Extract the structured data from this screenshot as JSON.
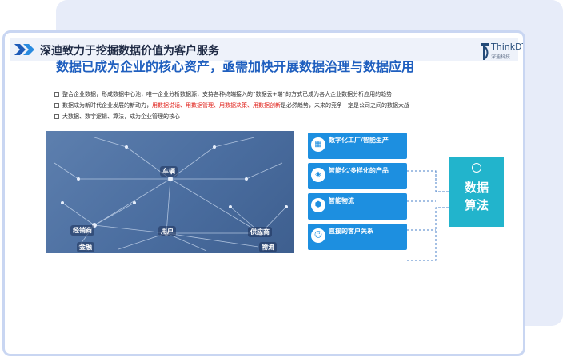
{
  "header": {
    "title": "深迪致力于挖掘数据价值为客户服务"
  },
  "logo": {
    "name": "ThinkDT",
    "subtitle": "深迪科技"
  },
  "headline": "数据已成为企业的核心资产，亟需加快开展数据治理与数据应用",
  "bullets": {
    "b1": "整合企业数据，形成数据中心池，唯一企业分析数据源，支持各种终端接入的“数据云+端”的方式已成为各大企业数据分析应用的趋势",
    "b2_prefix": "数据成为新时代企业发展的新动力，",
    "b2_highlight": "用数据说话、用数据管理、用数据决策、用数据创新",
    "b2_suffix": "是必然趋势，未来的竞争一定是公司之间的数据大战",
    "b3": "大数据、数字逻辑、算法，成为企业管理的核心"
  },
  "network": {
    "labels": {
      "vehicle": "车辆",
      "dealer": "经销商",
      "user": "用户",
      "supplier": "供应商",
      "finance": "金融",
      "logistics": "物流"
    }
  },
  "cards": [
    {
      "icon": "factory-icon",
      "title": "数字化工厂/智能生产",
      "desc": ""
    },
    {
      "icon": "product-icon",
      "title": "智能化/多样化的产品",
      "desc": ""
    },
    {
      "icon": "logistics-icon",
      "title": "智能物流",
      "desc": ""
    },
    {
      "icon": "customer-icon",
      "title": "直接的客户关系",
      "desc": ""
    }
  ],
  "algorithm": {
    "line1": "数据",
    "line2": "算法",
    "icon": "touch-icon"
  },
  "colors": {
    "headline": "#1f5fbf",
    "card": "#1d8fe0",
    "algo": "#22b4cc",
    "highlight": "#e0231c"
  }
}
